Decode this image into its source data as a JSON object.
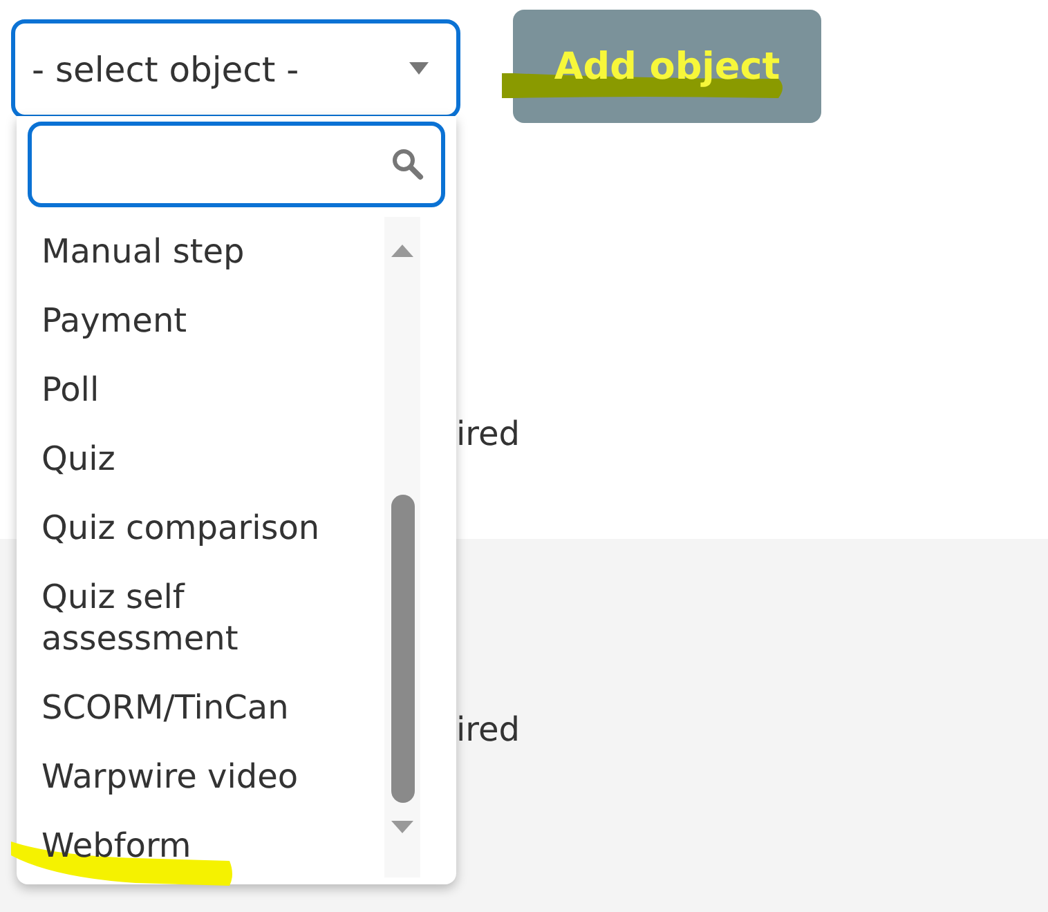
{
  "select": {
    "value": "- select object -",
    "open": true
  },
  "add_button": {
    "label": "Add object",
    "highlighted": true
  },
  "options": [
    {
      "label": "Manual step",
      "highlighted": false
    },
    {
      "label": "Payment",
      "highlighted": false
    },
    {
      "label": "Poll",
      "highlighted": false
    },
    {
      "label": "Quiz",
      "highlighted": false
    },
    {
      "label": "Quiz comparison",
      "highlighted": false
    },
    {
      "label": "Quiz self assessment",
      "highlighted": false
    },
    {
      "label": "SCORM/TinCan",
      "highlighted": false
    },
    {
      "label": "Warpwire video",
      "highlighted": false
    },
    {
      "label": "Webform",
      "highlighted": true
    }
  ],
  "background_rows": [
    {
      "text": "ired",
      "shaded": false
    },
    {
      "text": "ired",
      "shaded": true
    }
  ]
}
